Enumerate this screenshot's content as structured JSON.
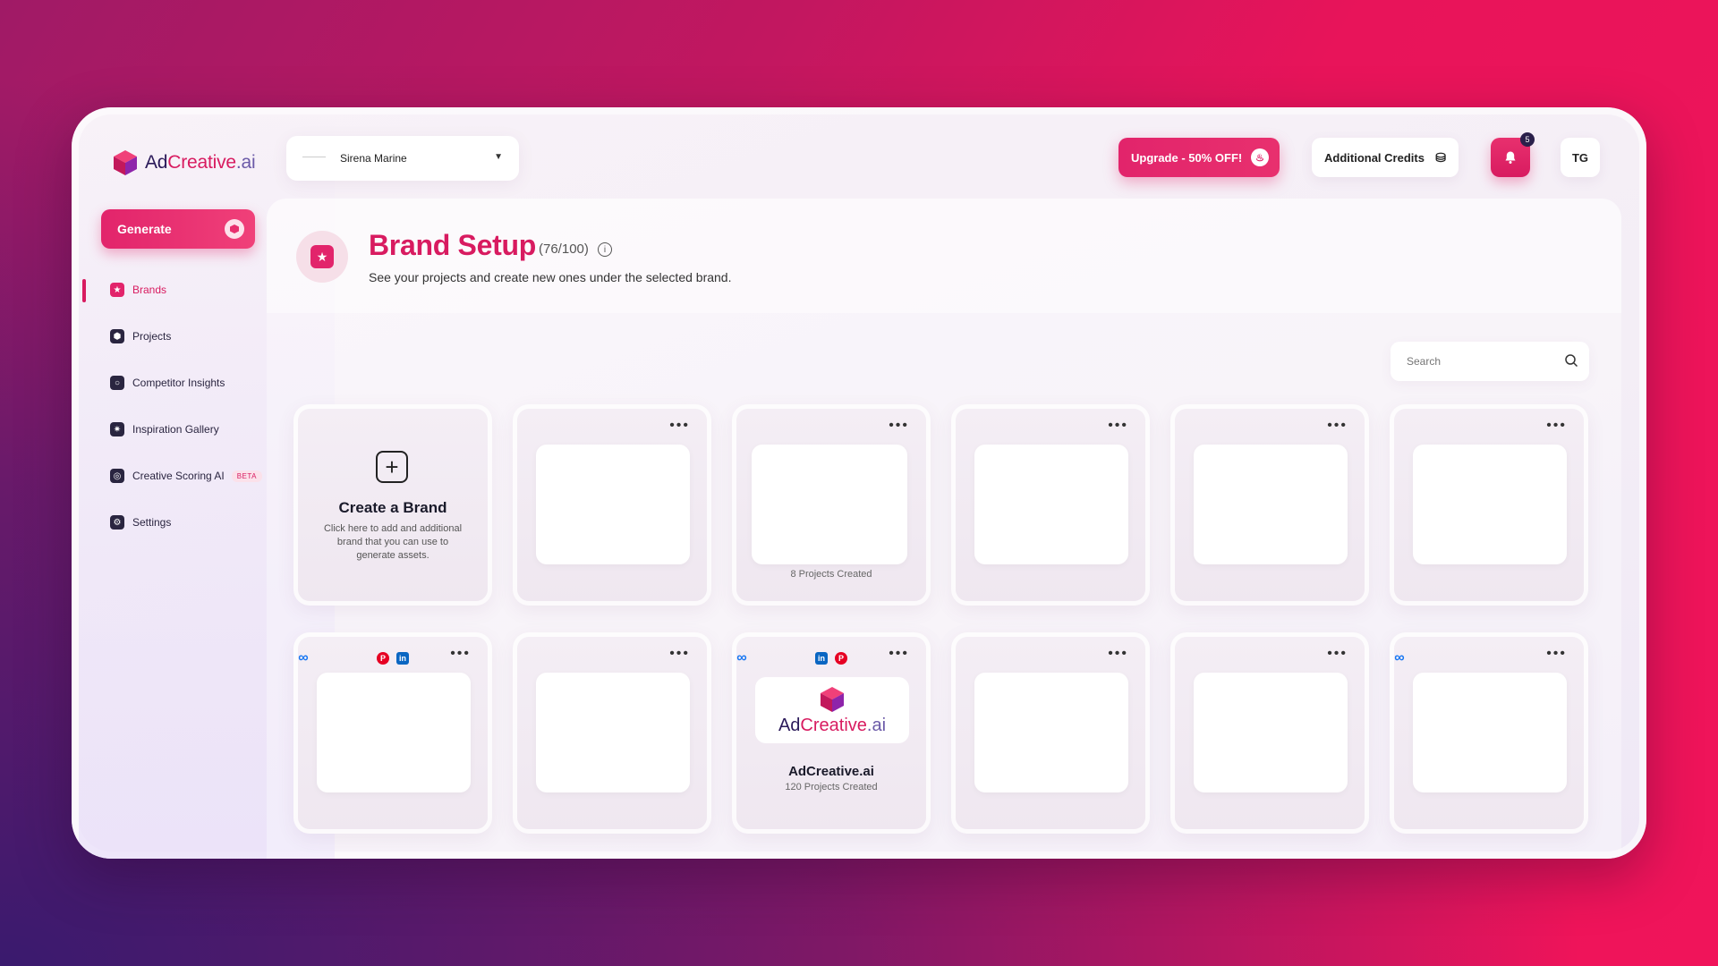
{
  "app": {
    "logo_text_a": "Ad",
    "logo_text_b": "Creative",
    "logo_text_c": ".ai"
  },
  "sidebar": {
    "generate_label": "Generate",
    "items": [
      {
        "label": "Brands",
        "icon": "star-icon",
        "active": true
      },
      {
        "label": "Projects",
        "icon": "cube-icon"
      },
      {
        "label": "Competitor Insights",
        "icon": "search-icon"
      },
      {
        "label": "Inspiration Gallery",
        "icon": "sparkle-icon"
      },
      {
        "label": "Creative Scoring AI",
        "icon": "score-icon",
        "badge": "BETA"
      },
      {
        "label": "Settings",
        "icon": "gear-icon"
      }
    ]
  },
  "header": {
    "brand_selected": "Sirena Marine",
    "upgrade_label": "Upgrade - 50% OFF!",
    "credits_label": "Additional Credits",
    "notifications_count": "5",
    "avatar_initials": "TG"
  },
  "page": {
    "title": "Brand Setup",
    "count": "(76/100)",
    "subtitle": "See your projects and create new ones under the selected brand.",
    "search_placeholder": "Search"
  },
  "create_card": {
    "title": "Create a Brand",
    "description": "Click here to add and additional brand that you can use to generate assets."
  },
  "cards": {
    "r1c3_meta": "8 Projects Created",
    "adc_name": "AdCreative.ai",
    "adc_meta": "120 Projects Created"
  },
  "colors": {
    "accent": "#d81b60",
    "dark": "#2a2540"
  }
}
